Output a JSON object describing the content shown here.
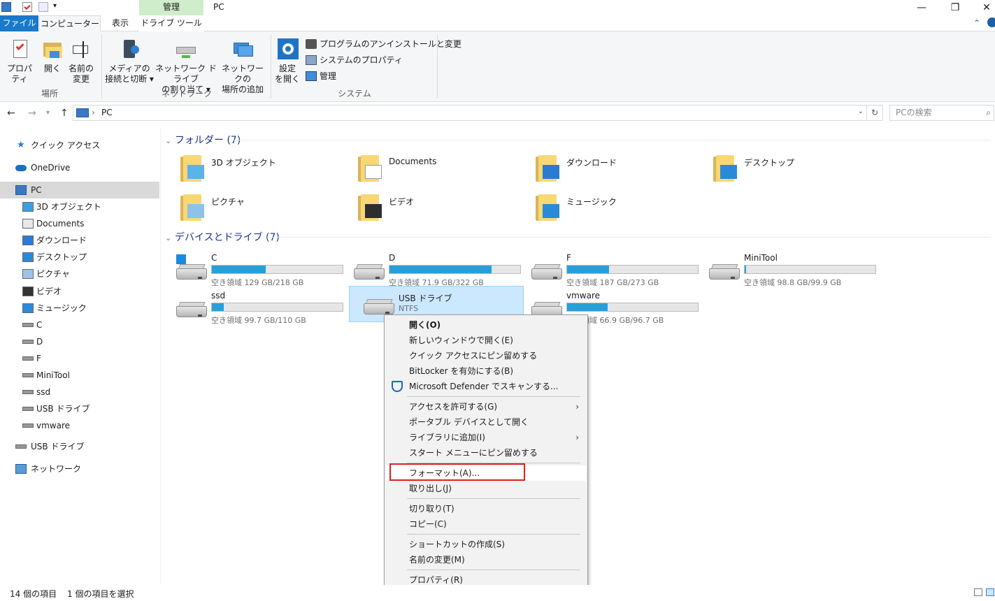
{
  "window": {
    "title": "PC",
    "context_tab": "管理",
    "tabs": {
      "file": "ファイル",
      "computer": "コンピューター",
      "view": "表示",
      "drive_tools": "ドライブ ツール"
    }
  },
  "ribbon": {
    "location": {
      "label": "場所",
      "properties": "プロパティ",
      "open": "開く",
      "rename_l1": "名前の",
      "rename_l2": "変更"
    },
    "network": {
      "label": "ネットワーク",
      "media_l1": "メディアの",
      "media_l2": "接続と切断 ▾",
      "map_l1": "ネットワーク ドライブ",
      "map_l2": "の割り当て ▾",
      "addloc_l1": "ネットワークの",
      "addloc_l2": "場所の追加"
    },
    "system": {
      "label": "システム",
      "settings_l1": "設定",
      "settings_l2": "を開く",
      "uninstall": "プログラムのアンインストールと変更",
      "sysprops": "システムのプロパティ",
      "manage": "管理"
    }
  },
  "address": {
    "separator": "›",
    "path": "PC",
    "search_placeholder": "PCの検索"
  },
  "nav": {
    "quick_access": "クイック アクセス",
    "onedrive": "OneDrive",
    "pc": "PC",
    "children": [
      "3D オブジェクト",
      "Documents",
      "ダウンロード",
      "デスクトップ",
      "ピクチャ",
      "ビデオ",
      "ミュージック",
      "C",
      "D",
      "F",
      "MiniTool",
      "ssd",
      "USB ドライブ",
      "vmware"
    ],
    "usb": "USB ドライブ",
    "network": "ネットワーク"
  },
  "folders_section": "フォルダー (7)",
  "folders": [
    "3D オブジェクト",
    "Documents",
    "ダウンロード",
    "デスクトップ",
    "ピクチャ",
    "ビデオ",
    "ミュージック"
  ],
  "drives_section": "デバイスとドライブ (7)",
  "drives": [
    {
      "name": "C",
      "info": "空き領域 129 GB/218 GB",
      "used_fraction": 0.41
    },
    {
      "name": "D",
      "info": "空き領域 71.9 GB/322 GB",
      "used_fraction": 0.78
    },
    {
      "name": "F",
      "info": "空き領域 187 GB/273 GB",
      "used_fraction": 0.32
    },
    {
      "name": "MiniTool",
      "info": "空き領域 98.8 GB/99.9 GB",
      "used_fraction": 0.01
    },
    {
      "name": "ssd",
      "info": "空き領域 99.7 GB/110 GB",
      "used_fraction": 0.09
    },
    {
      "name": "USB ドライブ",
      "info": "NTFS"
    },
    {
      "name": "vmware",
      "info": "空き領域 66.9 GB/96.7 GB",
      "used_fraction": 0.31
    }
  ],
  "context_menu": {
    "open": "開く(O)",
    "new_window": "新しいウィンドウで開く(E)",
    "pin_quick": "クイック アクセスにピン留めする",
    "bitlocker": "BitLocker を有効にする(B)",
    "defender": "Microsoft Defender でスキャンする...",
    "give_access": "アクセスを許可する(G)",
    "portable": "ポータブル デバイスとして開く",
    "library": "ライブラリに追加(I)",
    "pin_start": "スタート メニューにピン留めする",
    "format": "フォーマット(A)...",
    "eject": "取り出し(J)",
    "cut": "切り取り(T)",
    "copy": "コピー(C)",
    "shortcut": "ショートカットの作成(S)",
    "rename": "名前の変更(M)",
    "properties": "プロパティ(R)",
    "submenu_arrow": "›"
  },
  "status": {
    "items": "14 個の項目",
    "selected": "1 個の項目を選択"
  },
  "colors": {
    "accent": "#1979ca",
    "bar_fill": "#26a0da",
    "selection": "#cce8ff",
    "highlight_box": "#e02020"
  }
}
